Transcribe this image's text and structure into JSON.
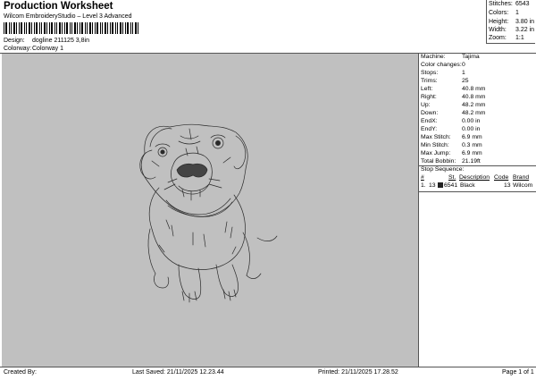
{
  "header": {
    "title": "Production Worksheet",
    "subtitle": "Wilcom EmbroideryStudio – Level 3 Advanced",
    "design_label": "Design:",
    "design_value": "dogline 211125 3,8in",
    "colorway_label": "Colorway:",
    "colorway_value": "Colorway 1"
  },
  "summary": [
    {
      "label": "Stitches:",
      "value": "6543"
    },
    {
      "label": "Colors:",
      "value": "1"
    },
    {
      "label": "Height:",
      "value": "3.80 in"
    },
    {
      "label": "Width:",
      "value": "3.22 in"
    },
    {
      "label": "Zoom:",
      "value": "1:1"
    }
  ],
  "stats": [
    {
      "label": "Machine:",
      "value": "Tajima"
    },
    {
      "label": "Color changes:",
      "value": "0"
    },
    {
      "label": "Stops:",
      "value": "1"
    },
    {
      "label": "Trims:",
      "value": "25"
    },
    {
      "label": "Left:",
      "value": "40.8 mm"
    },
    {
      "label": "Right:",
      "value": "40.8 mm"
    },
    {
      "label": "Up:",
      "value": "48.2 mm"
    },
    {
      "label": "Down:",
      "value": "48.2 mm"
    },
    {
      "label": "EndX:",
      "value": "0.00 in"
    },
    {
      "label": "EndY:",
      "value": "0.00 in"
    },
    {
      "label": "Max Stitch:",
      "value": "6.9 mm"
    },
    {
      "label": "Min Stitch:",
      "value": "0.3 mm"
    },
    {
      "label": "Max Jump:",
      "value": "6.9 mm"
    },
    {
      "label": "Total Bobbin:",
      "value": "21.19ft"
    }
  ],
  "stop_sequence": {
    "title": "Stop Sequence:",
    "headers": [
      "#",
      "St.",
      "Description",
      "Code",
      "Brand"
    ],
    "rows": [
      {
        "index": "1.",
        "stop": "13",
        "swatch_color": "#222222",
        "stitches": "6541",
        "description": "Black",
        "code": "13",
        "brand": "Wilcom"
      }
    ]
  },
  "footer": {
    "created_by": "Created By:",
    "last_saved": "Last Saved: 21/11/2025 12.23.44",
    "printed": "Printed: 21/11/2025 17.28.52",
    "page": "Page 1 of 1"
  },
  "colors": {
    "canvas_bg": "#c0c0c0",
    "stitch_line": "#2a2a2a"
  }
}
